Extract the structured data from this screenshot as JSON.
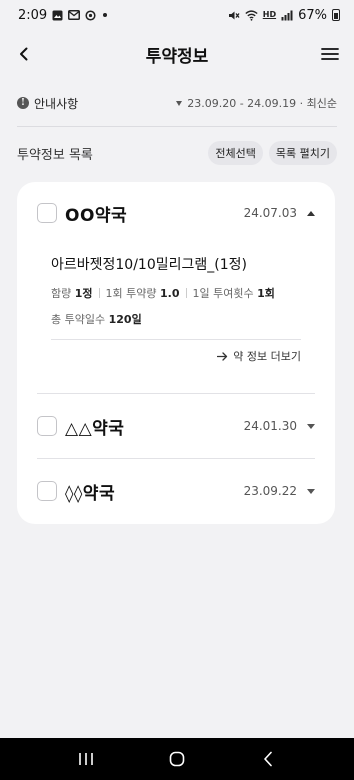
{
  "status_bar": {
    "time": "2:09",
    "battery": "67%",
    "network": "HD"
  },
  "header": {
    "title": "투약정보"
  },
  "notice": {
    "label": "안내사항",
    "period": "23.09.20 - 24.09.19 · 최신순"
  },
  "list": {
    "title": "투약정보 목록",
    "select_all": "전체선택",
    "expand_all": "목록 펼치기"
  },
  "pharmacies": [
    {
      "name": "OO약국",
      "date": "24.07.03",
      "expanded": true,
      "drug": {
        "name": "아르바젯정10/10밀리그램_(1정)",
        "dose_label": "함량",
        "dose_value": "1정",
        "once_label": "1회 투약량",
        "once_value": "1.0",
        "daily_label": "1일 투여횟수",
        "daily_value": "1회",
        "total_label": "총 투약일수",
        "total_value": "120일"
      },
      "more_label": "약 정보 더보기"
    },
    {
      "name": "△△약국",
      "date": "24.01.30",
      "expanded": false
    },
    {
      "name": "◊◊약국",
      "date": "23.09.22",
      "expanded": false
    }
  ]
}
